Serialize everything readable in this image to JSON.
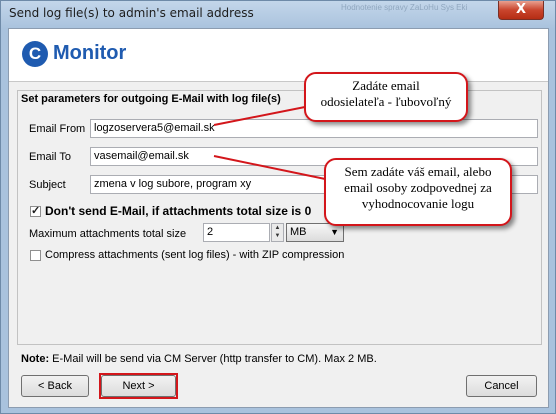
{
  "window": {
    "title": "Send log file(s) to admin's email address",
    "faded_text": "Hodnotenie spravy   ZaLoHu Sys Eki",
    "close_symbol": "X",
    "close_color": "#c9452d"
  },
  "logo": {
    "letter": "C",
    "word": "Monitor",
    "color": "#1f5bb0"
  },
  "group": {
    "title": "Set parameters for outgoing E-Mail with log file(s)"
  },
  "form": {
    "from_label": "Email From",
    "from_value": "logzoservera5@email.sk",
    "to_label": "Email To",
    "to_value": "vasemail@email.sk",
    "subject_label": "Subject",
    "subject_value": "zmena v log subore, program xy",
    "dont_send_label": "Don't send E-Mail, if attachments total size is 0",
    "dont_send_checked": true,
    "max_size_label": "Maximum attachments total size",
    "max_size_value": "2",
    "unit_value": "MB",
    "compress_label": "Compress attachments (sent log files) - with ZIP compression",
    "compress_checked": false
  },
  "note": {
    "prefix": "Note:",
    "text": " E-Mail will be send via CM Server (http transfer to CM). Max 2 MB."
  },
  "buttons": {
    "back": "< Back",
    "next": "Next >",
    "cancel": "Cancel"
  },
  "annotations": {
    "callout1_line1": "Zadáte email",
    "callout1_line2": "odosielateľa - ľubovoľný",
    "callout2_line1": "Sem zadáte váš email, alebo",
    "callout2_line2": "email osoby zodpovednej za",
    "callout2_line3": "vyhodnocovanie logu",
    "color": "#d3161b"
  }
}
